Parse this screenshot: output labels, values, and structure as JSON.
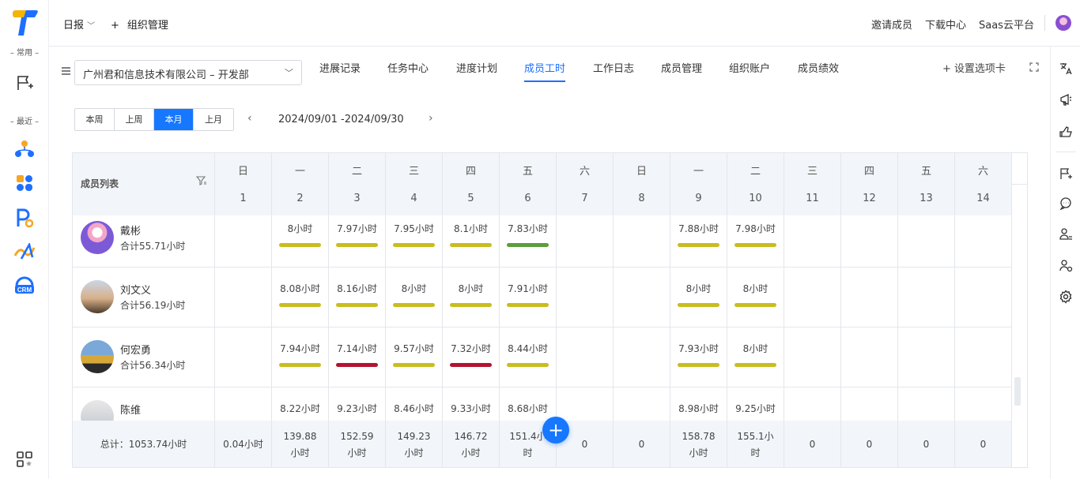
{
  "left_rail": {
    "common_label": "– 常用 –",
    "recent_label": "– 最近 –",
    "crm_label": "CRM",
    "icons": [
      "new-flag-icon",
      "org-structure-icon",
      "apps-icon",
      "p-app-icon",
      "link-app-icon",
      "crm-icon",
      "grid-apps-icon"
    ]
  },
  "topbar": {
    "daily": "日报",
    "plus": "+",
    "org_manage": "组织管理",
    "invite": "邀请成员",
    "download": "下载中心",
    "saas": "Saas云平台"
  },
  "toolbar": {
    "org_select": "广州君和信息技术有限公司 – 开发部",
    "tabs": [
      "进展记录",
      "任务中心",
      "进度计划",
      "成员工时",
      "工作日志",
      "成员管理",
      "组织账户",
      "成员绩效"
    ],
    "active_tab": 3,
    "settings_tab": "设置选项卡"
  },
  "period": {
    "buttons": [
      "本周",
      "上周",
      "本月",
      "上月"
    ],
    "active": 2,
    "range": "2024/09/01  -2024/09/30"
  },
  "table": {
    "member_header": "成员列表",
    "weekdays": [
      "日",
      "一",
      "二",
      "三",
      "四",
      "五",
      "六",
      "日",
      "一",
      "二",
      "三",
      "四",
      "五",
      "六"
    ],
    "days": [
      "1",
      "2",
      "3",
      "4",
      "5",
      "6",
      "7",
      "8",
      "9",
      "10",
      "11",
      "12",
      "13",
      "14"
    ],
    "members": [
      {
        "name": "戴彬",
        "total": "合计55.71小时",
        "hours": [
          "",
          "8小时",
          "7.97小时",
          "7.95小时",
          "8.1小时",
          "7.83小时",
          "",
          "",
          "7.88小时",
          "7.98小时",
          "",
          "",
          "",
          ""
        ],
        "bars": [
          "",
          "#c9bd1e",
          "#c9bd1e",
          "#c9bd1e",
          "#c9bd1e",
          "#5a9e3a",
          "",
          "",
          "#c9bd1e",
          "#c9bd1e",
          "",
          "",
          "",
          ""
        ]
      },
      {
        "name": "刘文义",
        "total": "合计56.19小时",
        "hours": [
          "",
          "8.08小时",
          "8.16小时",
          "8小时",
          "8小时",
          "7.91小时",
          "",
          "",
          "8小时",
          "8小时",
          "",
          "",
          "",
          ""
        ],
        "bars": [
          "",
          "#c9bd1e",
          "#c9bd1e",
          "#c9bd1e",
          "#c9bd1e",
          "#c9bd1e",
          "",
          "",
          "#c9bd1e",
          "#c9bd1e",
          "",
          "",
          "",
          ""
        ]
      },
      {
        "name": "何宏勇",
        "total": "合计56.34小时",
        "hours": [
          "",
          "7.94小时",
          "7.14小时",
          "9.57小时",
          "7.32小时",
          "8.44小时",
          "",
          "",
          "7.93小时",
          "8小时",
          "",
          "",
          "",
          ""
        ],
        "bars": [
          "",
          "#c9bd1e",
          "#b3142f",
          "#c9bd1e",
          "#b3142f",
          "#c9bd1e",
          "",
          "",
          "#c9bd1e",
          "#c9bd1e",
          "",
          "",
          "",
          ""
        ]
      },
      {
        "name": "陈维",
        "total": "",
        "hours": [
          "",
          "8.22小时",
          "9.23小时",
          "8.46小时",
          "9.33小时",
          "8.68小时",
          "",
          "",
          "8.98小时",
          "9.25小时",
          "",
          "",
          "",
          ""
        ],
        "bars": [
          "",
          "",
          "",
          "",
          "",
          "",
          "",
          "",
          "",
          "",
          "",
          "",
          "",
          ""
        ]
      }
    ],
    "footer_label": "总计：1053.74小时",
    "footer": [
      "0.04小时",
      "139.88\n小时",
      "152.59\n小时",
      "149.23\n小时",
      "146.72\n小时",
      "151.4小\n时",
      "0",
      "0",
      "158.78\n小时",
      "155.1小\n时",
      "0",
      "0",
      "0",
      "0"
    ]
  },
  "colors": {
    "accent": "#1677ff",
    "bar_normal": "#c9bd1e",
    "bar_low": "#b3142f",
    "bar_good": "#5a9e3a"
  }
}
